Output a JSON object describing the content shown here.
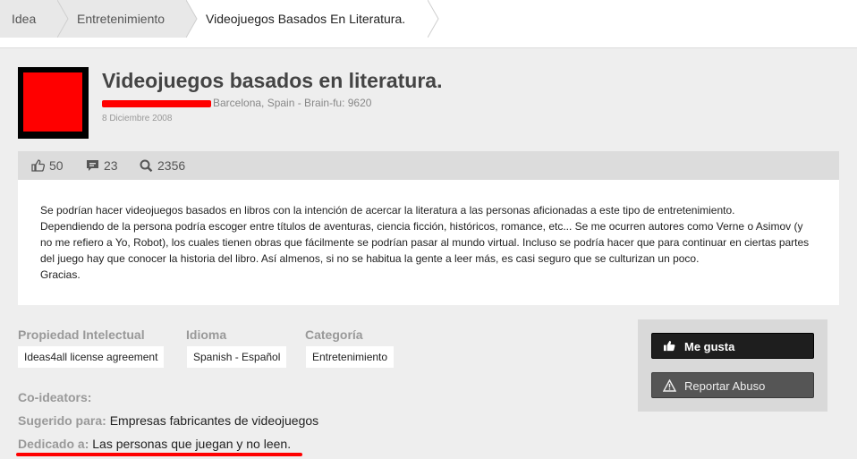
{
  "breadcrumb": [
    "Idea",
    "Entretenimiento",
    "Videojuegos Basados En Literatura."
  ],
  "idea": {
    "title": "Videojuegos basados en literatura.",
    "location": "Barcelona, Spain - Brain-fu: 9620",
    "date": "8 Diciembre 2008"
  },
  "stats": {
    "likes": "50",
    "comments": "23",
    "views": "2356"
  },
  "description": [
    "Se podrían hacer videojuegos basados en libros con la intención de acercar la literatura a las personas aficionadas a este tipo de entretenimiento.",
    "Dependiendo de la persona podría escoger entre títulos de aventuras, ciencia ficción, históricos, romance, etc... Se me ocurren autores como Verne o Asimov (y no me refiero a Yo, Robot), los cuales tienen obras que fácilmente se podrían pasar al mundo virtual. Incluso se podría hacer que para continuar en ciertas partes del juego hay que conocer la historia del libro. Así almenos, si no se habitua la gente a leer más, es casi seguro que se culturizan un poco.",
    "Gracias."
  ],
  "meta": {
    "ip_label": "Propiedad Intelectual",
    "ip_value": "Ideas4all license agreement",
    "lang_label": "Idioma",
    "lang_value": "Spanish - Español",
    "cat_label": "Categoría",
    "cat_value": "Entretenimiento",
    "coideators_label": "Co-ideators:",
    "suggested_label": "Sugerido para:",
    "suggested_value": "Empresas fabricantes de videojuegos",
    "dedicated_label": "Dedicado a:",
    "dedicated_value": "Las personas que juegan y no leen."
  },
  "actions": {
    "like": "Me gusta",
    "report": "Reportar Abuso"
  },
  "icons": {
    "like": "thumbs-up-icon",
    "comments": "comment-icon",
    "views": "search-icon",
    "report": "warning-icon"
  },
  "colors": {
    "redaction": "#ff0000",
    "like_button": "#1e1e1e",
    "report_button": "#555555"
  }
}
